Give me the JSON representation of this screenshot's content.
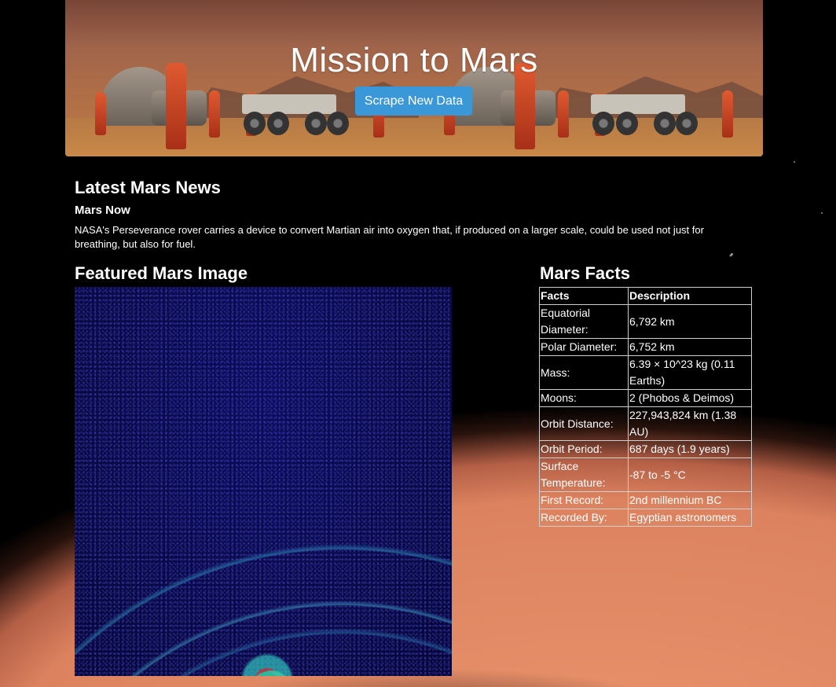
{
  "jumbotron": {
    "title": "Mission to Mars",
    "scrape_button_label": "Scrape New Data"
  },
  "news": {
    "heading": "Latest Mars News",
    "title": "Mars Now",
    "paragraph": "NASA's Perseverance rover carries a device to convert Martian air into oxygen that, if produced on a larger scale, could be used not just for breathing, but also for fuel."
  },
  "featured_image": {
    "heading": "Featured Mars Image"
  },
  "facts": {
    "heading": "Mars Facts",
    "columns": [
      "Facts",
      "Description"
    ],
    "rows": [
      [
        "Equatorial Diameter:",
        "6,792 km"
      ],
      [
        "Polar Diameter:",
        "6,752 km"
      ],
      [
        "Mass:",
        "6.39 × 10^23 kg (0.11 Earths)"
      ],
      [
        "Moons:",
        "2 (Phobos & Deimos)"
      ],
      [
        "Orbit Distance:",
        "227,943,824 km (1.38 AU)"
      ],
      [
        "Orbit Period:",
        "687 days (1.9 years)"
      ],
      [
        "Surface Temperature:",
        "-87 to -5 °C"
      ],
      [
        "First Record:",
        "2nd millennium BC"
      ],
      [
        "Recorded By:",
        "Egyptian astronomers"
      ]
    ]
  }
}
